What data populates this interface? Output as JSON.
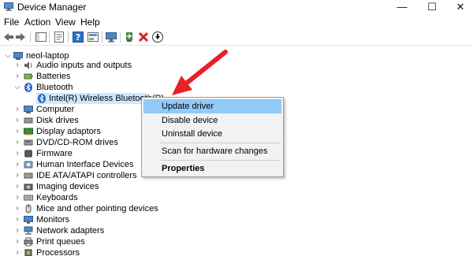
{
  "window": {
    "title": "Device Manager",
    "title_icon": "device-manager-icon",
    "minimize": "—",
    "maximize": "☐",
    "close": "✕"
  },
  "menu": {
    "items": [
      "File",
      "Action",
      "View",
      "Help"
    ]
  },
  "toolbar": {
    "icons": [
      "back-arrow-icon",
      "forward-arrow-icon",
      "show-hide-tree-icon",
      "properties-icon",
      "help-icon",
      "scan-hardware-icon",
      "monitor-icon",
      "add-driver-icon",
      "uninstall-red-x-icon",
      "download-driver-icon"
    ]
  },
  "tree": {
    "root": "neol-laptop",
    "items": [
      {
        "label": "Audio inputs and outputs",
        "expanded": false
      },
      {
        "label": "Batteries",
        "expanded": false
      },
      {
        "label": "Bluetooth",
        "expanded": true
      },
      {
        "label": "Intel(R) Wireless Bluetooth(R)",
        "child": true
      },
      {
        "label": "Computer",
        "expanded": false
      },
      {
        "label": "Disk drives",
        "expanded": false
      },
      {
        "label": "Display adaptors",
        "expanded": false
      },
      {
        "label": "DVD/CD-ROM drives",
        "expanded": false
      },
      {
        "label": "Firmware",
        "expanded": false
      },
      {
        "label": "Human Interface Devices",
        "expanded": false
      },
      {
        "label": "IDE ATA/ATAPI controllers",
        "expanded": false
      },
      {
        "label": "Imaging devices",
        "expanded": false
      },
      {
        "label": "Keyboards",
        "expanded": false
      },
      {
        "label": "Mice and other pointing devices",
        "expanded": false
      },
      {
        "label": "Monitors",
        "expanded": false
      },
      {
        "label": "Network adapters",
        "expanded": false
      },
      {
        "label": "Print queues",
        "expanded": false
      },
      {
        "label": "Processors",
        "expanded": false
      }
    ]
  },
  "context_menu": {
    "items": [
      "Update driver",
      "Disable device",
      "Uninstall device",
      "Scan for hardware changes",
      "Properties"
    ],
    "highlighted": "Update driver"
  },
  "colors": {
    "selection": "#cce8ff",
    "menu_highlight": "#91c9f7",
    "arrow": "#e8202a"
  }
}
